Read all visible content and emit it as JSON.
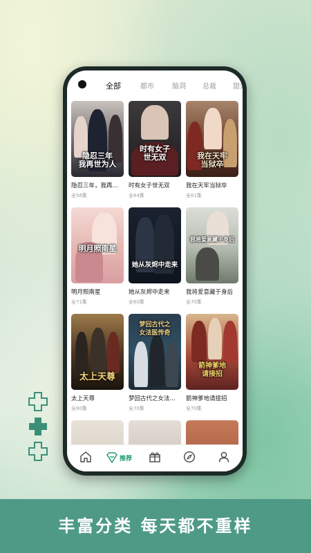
{
  "tabs": [
    {
      "label": "全部",
      "active": true
    },
    {
      "label": "都市"
    },
    {
      "label": "脑洞"
    },
    {
      "label": "总裁"
    },
    {
      "label": "甜宠"
    }
  ],
  "cards": [
    {
      "title": "隐忍三年，我再…",
      "episodes": "全56集",
      "poster_text": "隐忍三年\n我再世为人"
    },
    {
      "title": "时有女子世无双",
      "episodes": "全64集",
      "poster_text": "时有女子世无双"
    },
    {
      "title": "我在天牢当狱卒",
      "episodes": "全61集",
      "poster_text": "我在天牢当狱卒"
    },
    {
      "title": "明月照南星",
      "episodes": "全71集",
      "poster_text": "明月照南星"
    },
    {
      "title": "她从灰烬中走来",
      "episodes": "全60集",
      "poster_text": "她从灰烬中走来"
    },
    {
      "title": "我将爱意藏于身后",
      "episodes": "全70集",
      "poster_text": "我将爱意藏于身后"
    },
    {
      "title": "太上天尊",
      "episodes": "全80集",
      "poster_text": "太上天尊"
    },
    {
      "title": "梦回古代之女法…",
      "episodes": "全70集",
      "poster_text": "梦回古代之女法医传奇"
    },
    {
      "title": "箭神爹地请接招",
      "episodes": "全70集",
      "poster_text": "箭神爹地请接招"
    }
  ],
  "nav": {
    "recommend_label": "推荐",
    "items": [
      "home-icon",
      "recommend-icon",
      "gift-icon",
      "compass-icon",
      "user-icon"
    ],
    "accent": "#1e9b6e"
  },
  "banner": {
    "slogan": "丰富分类 每天都不重样",
    "background": "#4f9a86"
  }
}
